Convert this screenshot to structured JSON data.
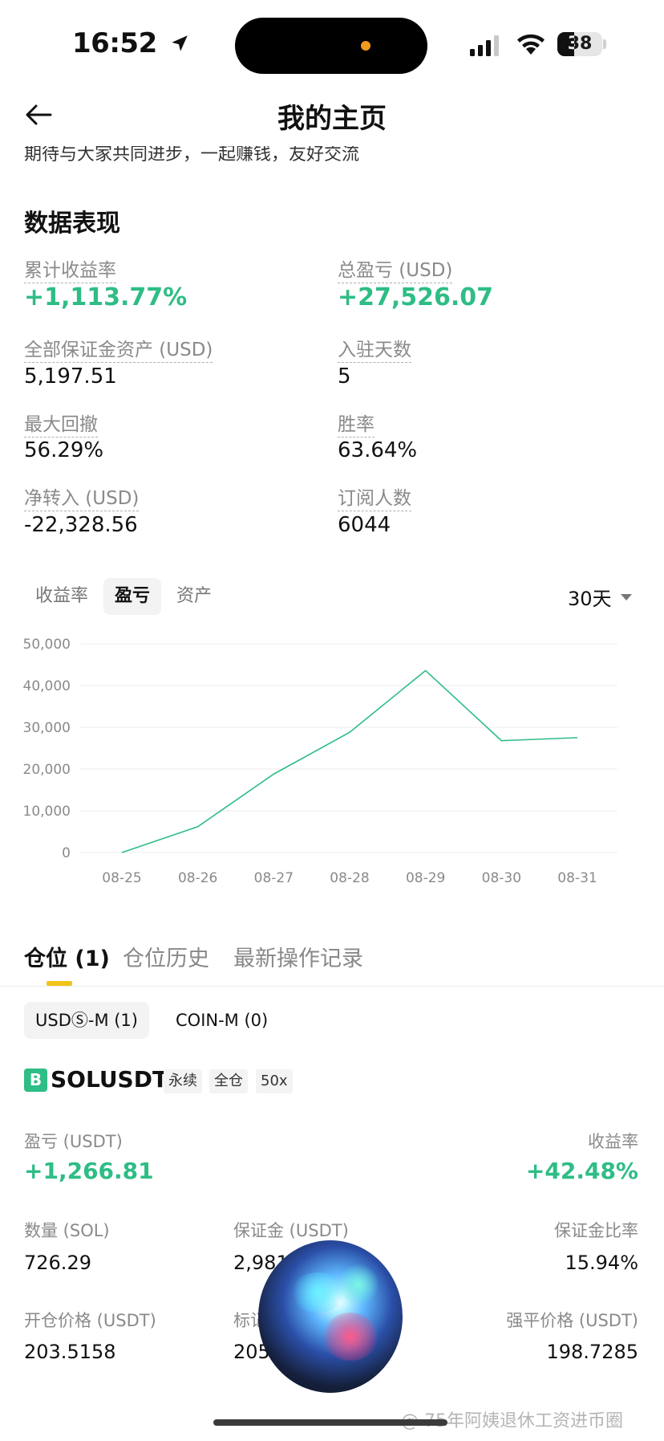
{
  "status_bar": {
    "time": "16:52",
    "battery": "38"
  },
  "header": {
    "title": "我的主页",
    "bio": "期待与大家共同进步，一起赚钱，友好交流"
  },
  "performance": {
    "title": "数据表现",
    "stats": [
      {
        "label": "累计收益率",
        "value": "+1,113.77%",
        "green": true
      },
      {
        "label": "总盈亏 (USD)",
        "value": "+27,526.07",
        "green": true
      },
      {
        "label": "全部保证金资产 (USD)",
        "value": "5,197.51"
      },
      {
        "label": "入驻天数",
        "value": "5"
      },
      {
        "label": "最大回撤",
        "value": "56.29%"
      },
      {
        "label": "胜率",
        "value": "63.64%"
      },
      {
        "label": "净转入 (USD)",
        "value": "-22,328.56"
      },
      {
        "label": "订阅人数",
        "value": "6044"
      }
    ]
  },
  "chart_tabs": [
    "收益率",
    "盈亏",
    "资产"
  ],
  "chart_period": "30天",
  "chart_data": {
    "type": "line",
    "categories": [
      "08-25",
      "08-26",
      "08-27",
      "08-28",
      "08-29",
      "08-30",
      "08-31"
    ],
    "values": [
      0,
      6200,
      18800,
      28800,
      43600,
      26800,
      27526
    ],
    "yticks": [
      "50,000",
      "40,000",
      "30,000",
      "20,000",
      "10,000",
      "0"
    ],
    "ylim": [
      0,
      50000
    ],
    "line_color": "#2ebd85",
    "grid": true
  },
  "positions": {
    "tabs": [
      "仓位 (1)",
      "仓位历史",
      "最新操作记录"
    ],
    "subtabs": [
      "USDⓈ-M (1)",
      "COIN-M (0)"
    ],
    "badge": "B",
    "symbol": "SOLUSDT",
    "tags": [
      "永续",
      "全仓",
      "50x"
    ],
    "pnl_label": "盈亏 (USDT)",
    "pnl_value": "+1,266.81",
    "roe_label": "收益率",
    "roe_value": "+42.48%",
    "qty_label": "数量 (SOL)",
    "qty_value": "726.29",
    "margin_label": "保证金 (USDT)",
    "margin_value": "2,981",
    "margin_ratio_label": "保证金比率",
    "margin_ratio_value": "15.94%",
    "entry_label": "开仓价格 (USDT)",
    "entry_value": "203.5158",
    "mark_label": "标记",
    "mark_value": "205",
    "liq_label": "强平价格 (USDT)",
    "liq_value": "198.7285"
  },
  "watermark": "@ 75年阿姨退休工资进币圈"
}
